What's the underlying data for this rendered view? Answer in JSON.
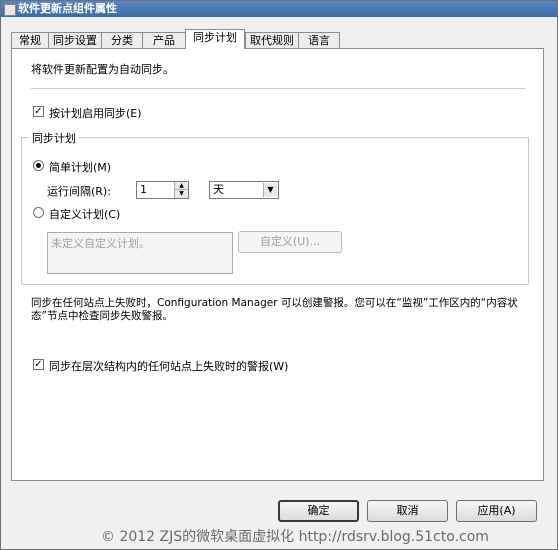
{
  "window": {
    "title": "软件更新点组件属性"
  },
  "tabs": [
    {
      "label": "常规"
    },
    {
      "label": "同步设置"
    },
    {
      "label": "分类"
    },
    {
      "label": "产品"
    },
    {
      "label": "同步计划"
    },
    {
      "label": "取代规则"
    },
    {
      "label": "语言"
    }
  ],
  "panel": {
    "description": "将软件更新配置为自动同步。",
    "enable_schedule": {
      "label": "按计划启用同步(E)",
      "checked": true
    },
    "schedule_group": {
      "title": "同步计划",
      "simple": {
        "label": "简单计划(M)",
        "selected": true
      },
      "interval_label": "运行间隔(R):",
      "interval_value": "1",
      "interval_unit": "天",
      "custom": {
        "label": "自定义计划(C)",
        "selected": false
      },
      "custom_placeholder": "未定义自定义计划。",
      "custom_button": "自定义(U)..."
    },
    "info_line1": "同步在任何站点上失败时，Configuration Manager 可以创建警报。您可以在“监视”工作区内的“内容状",
    "info_line2": "态”节点中检查同步失败警报。",
    "alert_checkbox": {
      "label": "同步在层次结构内的任何站点上失败时的警报(W)",
      "checked": true
    }
  },
  "buttons": {
    "ok": "确定",
    "cancel": "取消",
    "apply": "应用(A)"
  },
  "watermark": "© 2012 ZJS的微软桌面虚拟化 http://rdsrv.blog.51cto.com"
}
